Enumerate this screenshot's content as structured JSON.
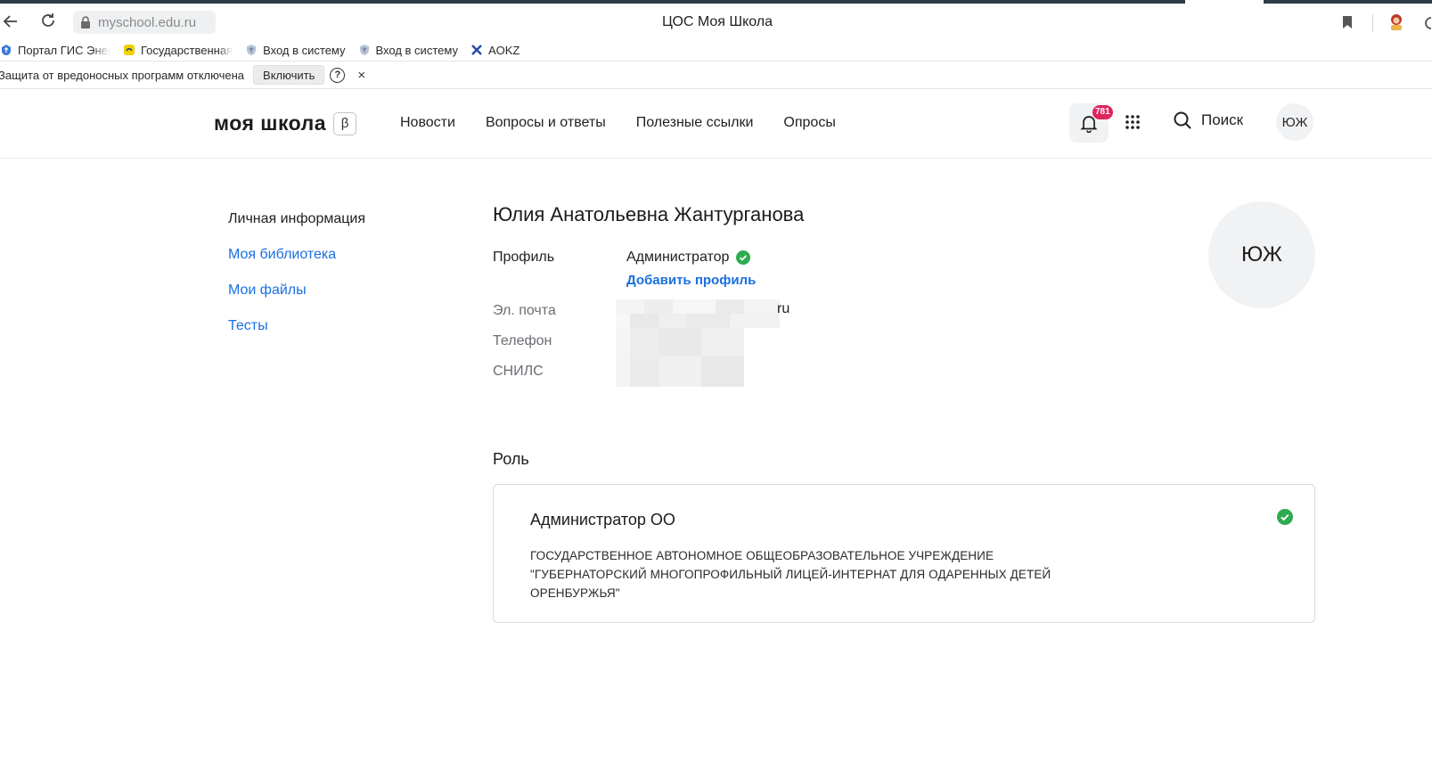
{
  "browser": {
    "url": "myschool.edu.ru",
    "tab_title": "ЦОС Моя Школа",
    "bookmarks": [
      {
        "label": "Портал ГИС Энер",
        "icon": "gov-emblem-icon"
      },
      {
        "label": "Государственная",
        "icon": "gosuslugi-icon"
      },
      {
        "label": "Вход в систему",
        "icon": "shield-emblem-icon"
      },
      {
        "label": "Вход в систему",
        "icon": "shield-emblem-icon"
      },
      {
        "label": "AOKZ",
        "icon": "aokz-x-icon"
      }
    ],
    "infobar": {
      "message": "Защита от вредоносных программ отключена",
      "enable_label": "Включить",
      "help_label": "?",
      "close_label": "×"
    }
  },
  "header": {
    "logo_text": "моя школа",
    "beta_label": "β",
    "nav": [
      "Новости",
      "Вопросы и ответы",
      "Полезные ссылки",
      "Опросы"
    ],
    "notifications_badge": "781",
    "search_label": "Поиск",
    "avatar_initials": "ЮЖ"
  },
  "sidebar": {
    "items": [
      {
        "label": "Личная информация",
        "active": true
      },
      {
        "label": "Моя библиотека",
        "active": false
      },
      {
        "label": "Мои файлы",
        "active": false
      },
      {
        "label": "Тесты",
        "active": false
      }
    ]
  },
  "profile": {
    "full_name": "Юлия Анатольевна Жантурганова",
    "profile_label": "Профиль",
    "profile_value": "Администратор",
    "add_profile_label": "Добавить профиль",
    "email_label": "Эл. почта",
    "email_visible_tail": "ru",
    "phone_label": "Телефон",
    "snils_label": "СНИЛС",
    "avatar_initials": "ЮЖ"
  },
  "role": {
    "section_title": "Роль",
    "name": "Администратор ОО",
    "organization": "ГОСУДАРСТВЕННОЕ АВТОНОМНОЕ ОБЩЕОБРАЗОВАТЕЛЬНОЕ УЧРЕЖДЕНИЕ \"ГУБЕРНАТОРСКИЙ МНОГОПРОФИЛЬНЫЙ ЛИЦЕЙ-ИНТЕРНАТ ДЛЯ ОДАРЕННЫХ ДЕТЕЙ ОРЕНБУРЖЬЯ\""
  },
  "colors": {
    "link": "#1a6fe0",
    "success": "#2eaa4f",
    "badge": "#e0245e",
    "soft_bg": "#f1f2f4"
  }
}
